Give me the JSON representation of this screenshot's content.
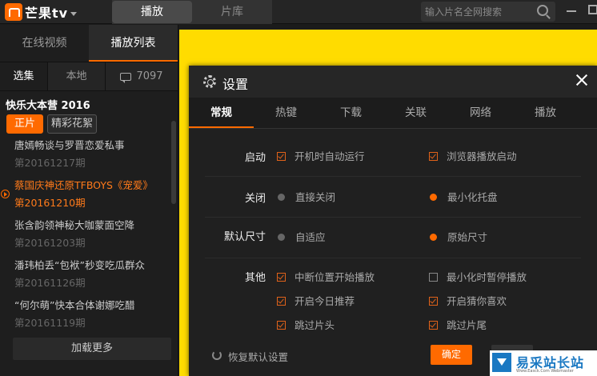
{
  "app": {
    "logo_text": "芒果tv"
  },
  "main_tabs": [
    {
      "label": "播放",
      "active": true
    },
    {
      "label": "片库",
      "active": false
    }
  ],
  "search": {
    "placeholder": "输入片名全网搜索",
    "icon": "search-icon"
  },
  "sidebar": {
    "tabs": [
      {
        "label": "在线视频",
        "active": false
      },
      {
        "label": "播放列表",
        "active": true
      }
    ],
    "sub_tabs": [
      {
        "label": "选集",
        "active": true
      },
      {
        "label": "本地",
        "active": false
      },
      {
        "label": "7097",
        "icon": "comment-icon",
        "active": false
      }
    ],
    "show_title": "快乐大本营 2016",
    "chips": [
      {
        "label": "正片",
        "active": true
      },
      {
        "label": "精彩花絮",
        "active": false
      }
    ],
    "episodes": [
      {
        "title": "唐嫣畅谈与罗晋恋爱私事",
        "date": "第20161217期",
        "current": false
      },
      {
        "title": "蔡国庆神还原TFBOYS《宠爱》",
        "date": "第20161210期",
        "current": true
      },
      {
        "title": "张含韵领神秘大咖蒙面空降",
        "date": "第20161203期",
        "current": false
      },
      {
        "title": "潘玮柏丢“包袱”秒变吃瓜群众",
        "date": "第20161126期",
        "current": false
      },
      {
        "title": "“何尔萌”快本合体谢娜吃醋",
        "date": "第20161119期",
        "current": false
      }
    ],
    "load_more": "加载更多"
  },
  "settings": {
    "title": "设置",
    "tabs": [
      {
        "label": "常规",
        "active": true
      },
      {
        "label": "热键",
        "active": false
      },
      {
        "label": "下载",
        "active": false
      },
      {
        "label": "关联",
        "active": false
      },
      {
        "label": "网络",
        "active": false
      },
      {
        "label": "播放",
        "active": false
      }
    ],
    "rows": [
      {
        "label": "启动",
        "options": [
          {
            "label": "开机时自动运行",
            "type": "checkbox",
            "checked": true
          },
          {
            "label": "浏览器播放启动",
            "type": "checkbox",
            "checked": true
          }
        ]
      },
      {
        "label": "关闭",
        "options": [
          {
            "label": "直接关闭",
            "type": "radio",
            "checked": false
          },
          {
            "label": "最小化托盘",
            "type": "radio",
            "checked": true
          }
        ]
      },
      {
        "label": "默认尺寸",
        "options": [
          {
            "label": "自适应",
            "type": "radio",
            "checked": false
          },
          {
            "label": "原始尺寸",
            "type": "radio",
            "checked": true
          }
        ]
      },
      {
        "label": "其他",
        "options": [
          {
            "label": "中断位置开始播放",
            "type": "checkbox",
            "checked": true
          },
          {
            "label": "最小化时暂停播放",
            "type": "checkbox",
            "checked": false
          },
          {
            "label": "开启今日推荐",
            "type": "checkbox",
            "checked": true
          },
          {
            "label": "开启猜你喜欢",
            "type": "checkbox",
            "checked": true
          },
          {
            "label": "跳过片头",
            "type": "checkbox",
            "checked": true
          },
          {
            "label": "跳过片尾",
            "type": "checkbox",
            "checked": true
          }
        ]
      }
    ],
    "restore_label": "恢复默认设置",
    "ok_label": "确定"
  },
  "watermark": {
    "text": "易采站长站",
    "sub": "Www.Easck.Com Webmaster"
  },
  "colors": {
    "accent": "#ff6a00",
    "player_bg": "#ffdc00",
    "panel_bg": "#202020"
  }
}
